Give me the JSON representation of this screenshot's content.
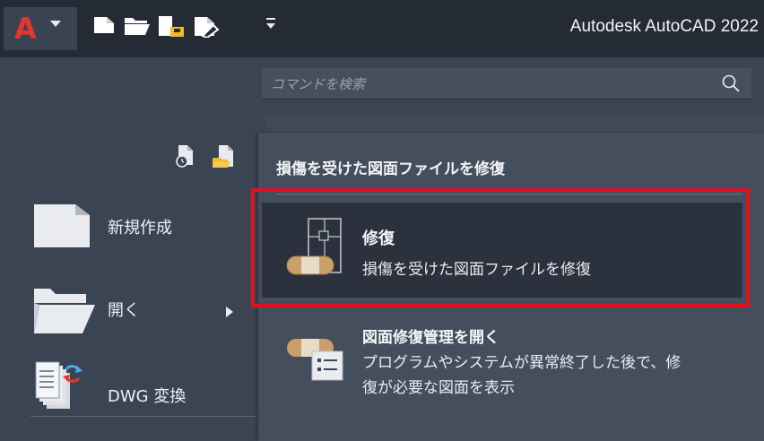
{
  "window": {
    "title": "Autodesk AutoCAD 2022"
  },
  "quick_access": {
    "icons": [
      "new-file-icon",
      "open-folder-icon",
      "save-icon",
      "save-as-icon"
    ],
    "more_icon": "customize-dropdown-icon"
  },
  "search": {
    "placeholder": "コマンドを検索",
    "value": ""
  },
  "left_menu": {
    "items": [
      {
        "label": "新規作成",
        "icon": "new-document-icon"
      },
      {
        "label": "開く",
        "icon": "open-folder-icon",
        "has_submenu": true
      },
      {
        "label": "DWG 変換",
        "icon": "dwg-convert-icon"
      }
    ]
  },
  "submenu": {
    "header": "損傷を受けた図面ファイルを修復",
    "items": [
      {
        "title": "修復",
        "description": "損傷を受けた図面ファイルを修復",
        "icon": "repair-icon",
        "highlighted": true
      },
      {
        "title": "図面修復管理を開く",
        "description_line1": "プログラムやシステムが異常終了した後で、修",
        "description_line2": "復が必要な図面を表示",
        "icon": "drawing-recovery-icon"
      }
    ]
  },
  "colors": {
    "accent_red": "#e0141c",
    "titlebar": "#252b35",
    "panel": "#3b4453",
    "submenu": "#454e5c",
    "highlight": "#2c323d"
  }
}
